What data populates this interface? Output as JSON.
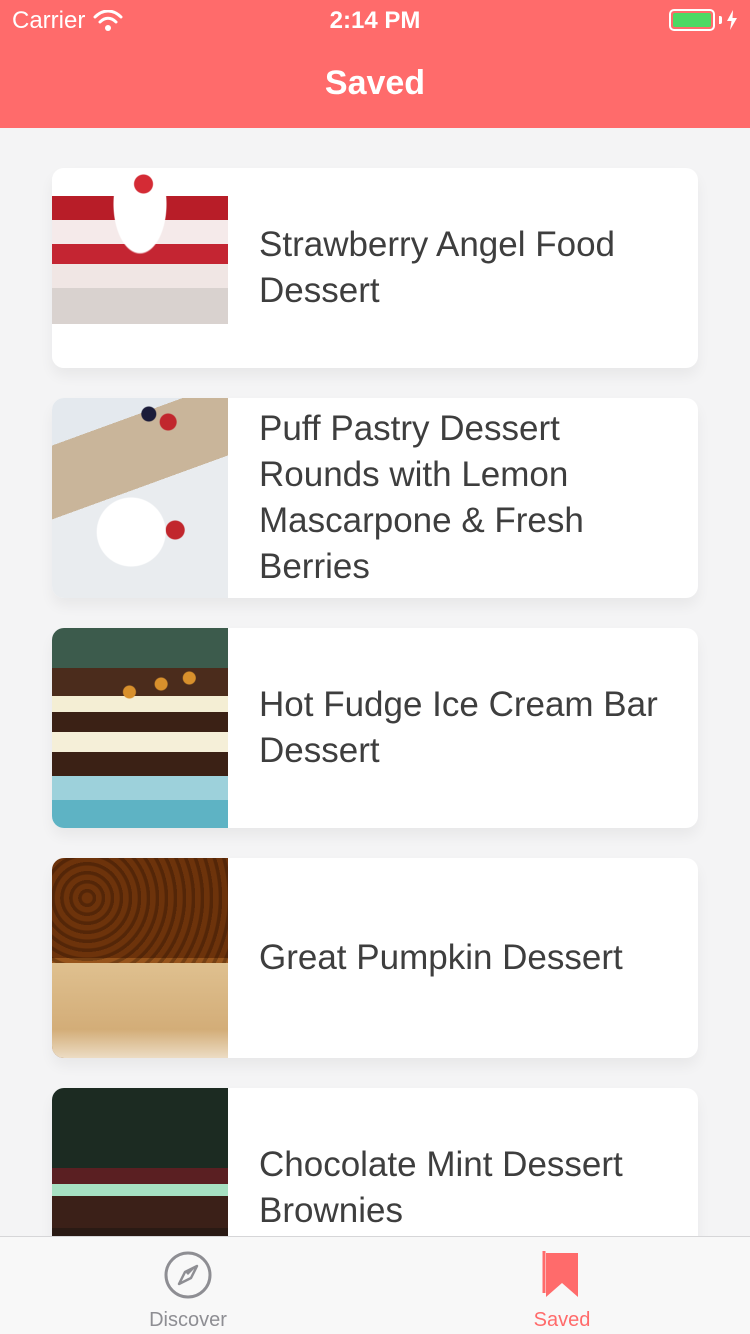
{
  "status_bar": {
    "carrier": "Carrier",
    "time": "2:14 PM"
  },
  "nav": {
    "title": "Saved"
  },
  "saved_items": [
    {
      "title": "Strawberry Angel Food Dessert",
      "image": "strawberry-trifle-photo"
    },
    {
      "title": "Puff Pastry Dessert Rounds with Lemon Mascarpone & Fresh Berries",
      "image": "puff-pastry-rounds-photo"
    },
    {
      "title": "Hot Fudge Ice Cream Bar Dessert",
      "image": "ice-cream-bar-photo"
    },
    {
      "title": "Great Pumpkin Dessert",
      "image": "pumpkin-dessert-photo"
    },
    {
      "title": "Chocolate Mint Dessert Brownies",
      "image": "mint-brownies-photo"
    }
  ],
  "tabbar": {
    "discover_label": "Discover",
    "saved_label": "Saved"
  },
  "colors": {
    "brand": "#ff6b6b",
    "background": "#f4f4f5",
    "text": "#3e3e3e",
    "inactive_tab": "#8e8e93",
    "battery": "#4cd964"
  },
  "icons": {
    "wifi": "wifi-icon",
    "battery": "battery-icon",
    "charging": "bolt-icon",
    "discover": "compass-icon",
    "saved": "bookmark-icon"
  }
}
